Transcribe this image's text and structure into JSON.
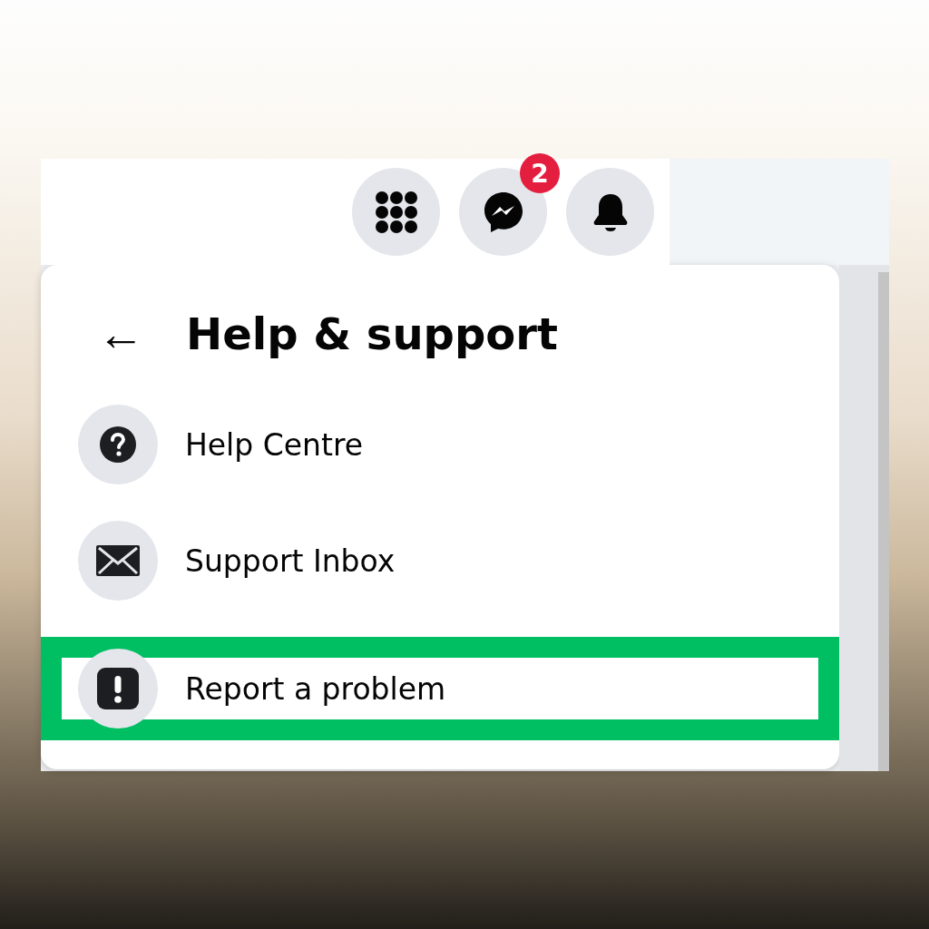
{
  "top_bar": {
    "buttons": [
      {
        "kind": "menu"
      },
      {
        "kind": "messenger",
        "badge": "2"
      },
      {
        "kind": "notifications"
      }
    ]
  },
  "panel": {
    "title": "Help & support",
    "back": "←",
    "items": [
      {
        "kind": "help",
        "label": "Help Centre",
        "highlighted": false
      },
      {
        "kind": "inbox",
        "label": "Support Inbox",
        "highlighted": false
      },
      {
        "kind": "report",
        "label": "Report a problem",
        "highlighted": true
      }
    ]
  }
}
